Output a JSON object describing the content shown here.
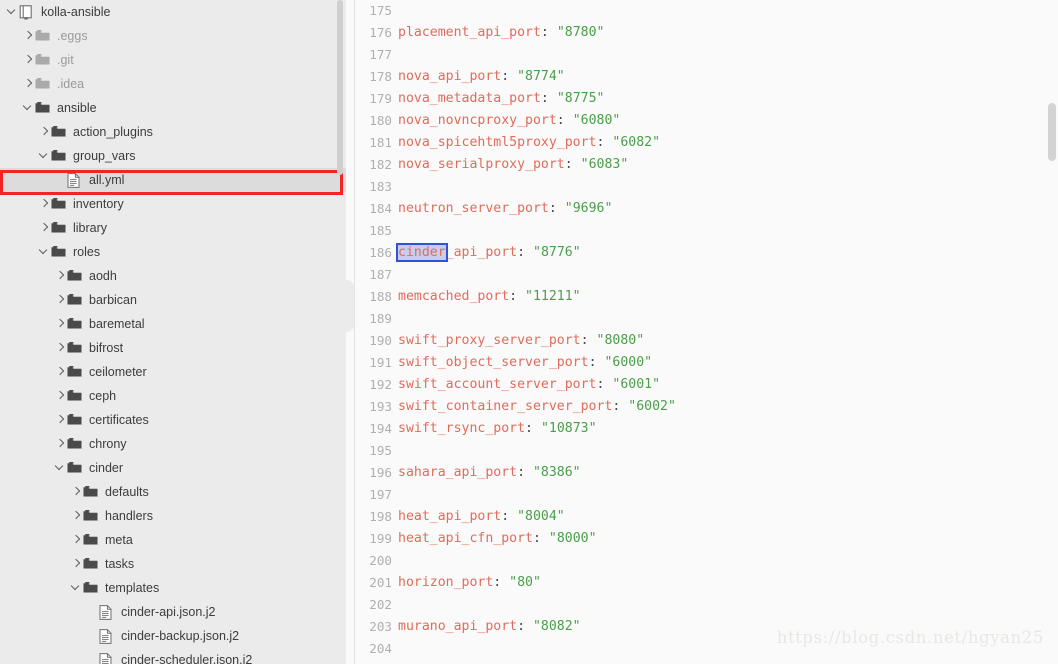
{
  "project": {
    "name": "kolla-ansible",
    "icon": "module-icon"
  },
  "sidebar": {
    "scrollbar_present": true,
    "selected_item": "all.yml",
    "annotation_color": "#f22424",
    "background": "#ebebeb",
    "items": [
      {
        "label": "kolla-ansible",
        "depth": 0,
        "arrow": "down",
        "icon": "module-icon",
        "dim": false,
        "selected": false
      },
      {
        "label": ".eggs",
        "depth": 1,
        "arrow": "right",
        "icon": "folder-muted",
        "dim": true,
        "selected": false
      },
      {
        "label": ".git",
        "depth": 1,
        "arrow": "right",
        "icon": "folder-muted",
        "dim": true,
        "selected": false
      },
      {
        "label": ".idea",
        "depth": 1,
        "arrow": "right",
        "icon": "folder-muted",
        "dim": true,
        "selected": false
      },
      {
        "label": "ansible",
        "depth": 1,
        "arrow": "down",
        "icon": "folder",
        "dim": false,
        "selected": false
      },
      {
        "label": "action_plugins",
        "depth": 2,
        "arrow": "right",
        "icon": "folder",
        "dim": false,
        "selected": false
      },
      {
        "label": "group_vars",
        "depth": 2,
        "arrow": "down",
        "icon": "folder",
        "dim": false,
        "selected": false
      },
      {
        "label": "all.yml",
        "depth": 3,
        "arrow": "none",
        "icon": "file",
        "dim": false,
        "selected": true
      },
      {
        "label": "inventory",
        "depth": 2,
        "arrow": "right",
        "icon": "folder",
        "dim": false,
        "selected": false
      },
      {
        "label": "library",
        "depth": 2,
        "arrow": "right",
        "icon": "folder",
        "dim": false,
        "selected": false
      },
      {
        "label": "roles",
        "depth": 2,
        "arrow": "down",
        "icon": "folder",
        "dim": false,
        "selected": false
      },
      {
        "label": "aodh",
        "depth": 3,
        "arrow": "right",
        "icon": "folder",
        "dim": false,
        "selected": false
      },
      {
        "label": "barbican",
        "depth": 3,
        "arrow": "right",
        "icon": "folder",
        "dim": false,
        "selected": false
      },
      {
        "label": "baremetal",
        "depth": 3,
        "arrow": "right",
        "icon": "folder",
        "dim": false,
        "selected": false
      },
      {
        "label": "bifrost",
        "depth": 3,
        "arrow": "right",
        "icon": "folder",
        "dim": false,
        "selected": false
      },
      {
        "label": "ceilometer",
        "depth": 3,
        "arrow": "right",
        "icon": "folder",
        "dim": false,
        "selected": false
      },
      {
        "label": "ceph",
        "depth": 3,
        "arrow": "right",
        "icon": "folder",
        "dim": false,
        "selected": false
      },
      {
        "label": "certificates",
        "depth": 3,
        "arrow": "right",
        "icon": "folder",
        "dim": false,
        "selected": false
      },
      {
        "label": "chrony",
        "depth": 3,
        "arrow": "right",
        "icon": "folder",
        "dim": false,
        "selected": false
      },
      {
        "label": "cinder",
        "depth": 3,
        "arrow": "down",
        "icon": "folder",
        "dim": false,
        "selected": false
      },
      {
        "label": "defaults",
        "depth": 4,
        "arrow": "right",
        "icon": "folder",
        "dim": false,
        "selected": false
      },
      {
        "label": "handlers",
        "depth": 4,
        "arrow": "right",
        "icon": "folder",
        "dim": false,
        "selected": false
      },
      {
        "label": "meta",
        "depth": 4,
        "arrow": "right",
        "icon": "folder",
        "dim": false,
        "selected": false
      },
      {
        "label": "tasks",
        "depth": 4,
        "arrow": "right",
        "icon": "folder",
        "dim": false,
        "selected": false
      },
      {
        "label": "templates",
        "depth": 4,
        "arrow": "down",
        "icon": "folder",
        "dim": false,
        "selected": false
      },
      {
        "label": "cinder-api.json.j2",
        "depth": 5,
        "arrow": "none",
        "icon": "file",
        "dim": false,
        "selected": false
      },
      {
        "label": "cinder-backup.json.j2",
        "depth": 5,
        "arrow": "none",
        "icon": "file",
        "dim": false,
        "selected": false
      },
      {
        "label": "cinder-scheduler.json.j2",
        "depth": 5,
        "arrow": "none",
        "icon": "file",
        "dim": false,
        "selected": false
      }
    ]
  },
  "editor": {
    "background": "#fafafa",
    "key_color": "#e06c5b",
    "value_color": "#4a9e4a",
    "punct_color": "#4a4a4a",
    "gutter_color": "#b0b0b0",
    "selection": {
      "token": "cinder",
      "line": 186,
      "border_color": "#3451d1",
      "fill_color": "#c5cdf0"
    },
    "first_line_number": 175,
    "lines": [
      {
        "n": 175,
        "key": "",
        "val": ""
      },
      {
        "n": 176,
        "key": "placement_api_port",
        "val": "\"8780\""
      },
      {
        "n": 177,
        "key": "",
        "val": ""
      },
      {
        "n": 178,
        "key": "nova_api_port",
        "val": "\"8774\""
      },
      {
        "n": 179,
        "key": "nova_metadata_port",
        "val": "\"8775\""
      },
      {
        "n": 180,
        "key": "nova_novncproxy_port",
        "val": "\"6080\""
      },
      {
        "n": 181,
        "key": "nova_spicehtml5proxy_port",
        "val": "\"6082\""
      },
      {
        "n": 182,
        "key": "nova_serialproxy_port",
        "val": "\"6083\""
      },
      {
        "n": 183,
        "key": "",
        "val": ""
      },
      {
        "n": 184,
        "key": "neutron_server_port",
        "val": "\"9696\""
      },
      {
        "n": 185,
        "key": "",
        "val": ""
      },
      {
        "n": 186,
        "key": "cinder_api_port",
        "val": "\"8776\"",
        "selected_prefix": "cinder",
        "rest": "_api_port"
      },
      {
        "n": 187,
        "key": "",
        "val": ""
      },
      {
        "n": 188,
        "key": "memcached_port",
        "val": "\"11211\""
      },
      {
        "n": 189,
        "key": "",
        "val": ""
      },
      {
        "n": 190,
        "key": "swift_proxy_server_port",
        "val": "\"8080\""
      },
      {
        "n": 191,
        "key": "swift_object_server_port",
        "val": "\"6000\""
      },
      {
        "n": 192,
        "key": "swift_account_server_port",
        "val": "\"6001\""
      },
      {
        "n": 193,
        "key": "swift_container_server_port",
        "val": "\"6002\""
      },
      {
        "n": 194,
        "key": "swift_rsync_port",
        "val": "\"10873\""
      },
      {
        "n": 195,
        "key": "",
        "val": ""
      },
      {
        "n": 196,
        "key": "sahara_api_port",
        "val": "\"8386\""
      },
      {
        "n": 197,
        "key": "",
        "val": ""
      },
      {
        "n": 198,
        "key": "heat_api_port",
        "val": "\"8004\""
      },
      {
        "n": 199,
        "key": "heat_api_cfn_port",
        "val": "\"8000\""
      },
      {
        "n": 200,
        "key": "",
        "val": ""
      },
      {
        "n": 201,
        "key": "horizon_port",
        "val": "\"80\""
      },
      {
        "n": 202,
        "key": "",
        "val": ""
      },
      {
        "n": 203,
        "key": "murano_api_port",
        "val": "\"8082\""
      },
      {
        "n": 204,
        "key": "",
        "val": ""
      }
    ]
  },
  "watermark": {
    "text": "https://blog.csdn.net/hgyan25"
  }
}
